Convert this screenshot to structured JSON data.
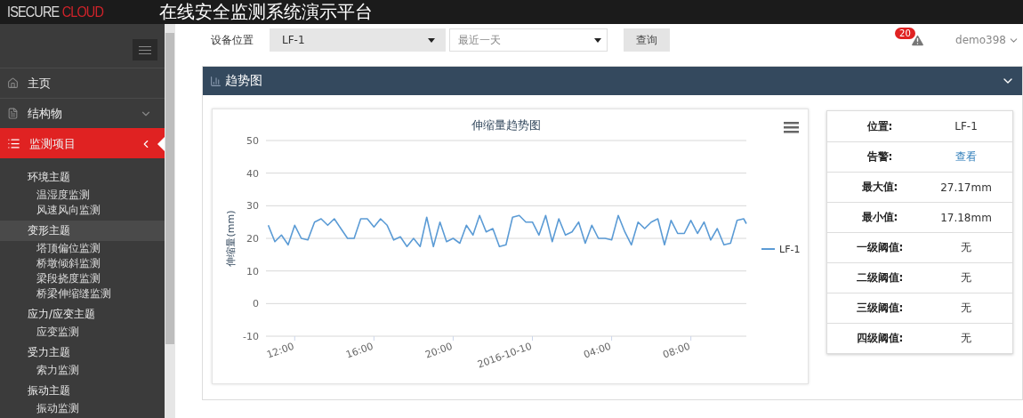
{
  "brand": {
    "part_1": "ISECURE",
    "part_2": "CLOUD"
  },
  "title": "在线安全监测系统演示平台",
  "sidebar": {
    "items": [
      {
        "label": "主页",
        "kind": "home",
        "selected": false
      },
      {
        "label": "结构物",
        "kind": "structure",
        "selected": false,
        "expanded": false
      },
      {
        "label": "监测项目",
        "kind": "monitoring",
        "selected": true,
        "expanded": true
      }
    ],
    "groups": [
      {
        "label": "环境主题",
        "selected": false,
        "children": [
          {
            "label": "温湿度监测"
          },
          {
            "label": "风速风向监测"
          }
        ]
      },
      {
        "label": "变形主题",
        "selected": true,
        "children": [
          {
            "label": "塔顶偏位监测"
          },
          {
            "label": "桥墩倾斜监测"
          },
          {
            "label": "梁段挠度监测"
          },
          {
            "label": "桥梁伸缩缝监测"
          }
        ]
      },
      {
        "label": "应力/应变主题",
        "selected": false,
        "children": [
          {
            "label": "应变监测"
          }
        ]
      },
      {
        "label": "受力主题",
        "selected": false,
        "children": [
          {
            "label": "索力监测"
          }
        ]
      },
      {
        "label": "振动主题",
        "selected": false,
        "children": [
          {
            "label": "振动监测"
          }
        ]
      }
    ]
  },
  "toolbar": {
    "location_label": "设备位置",
    "location": "LF-1",
    "range": "最近一天",
    "query_button": "查询",
    "alert_count": "20",
    "user": "demo398"
  },
  "panel": {
    "title": "趋势图",
    "chart_data": {
      "type": "line",
      "title": "伸缩量趋势图",
      "ylabel": "伸缩量(mm)",
      "grid": true,
      "xlim": [
        "2016-10-09T10:33",
        "2016-10-10T10:48"
      ],
      "ylim": [
        -10,
        50
      ],
      "yticks": [
        -10,
        0,
        10,
        20,
        30,
        40,
        50
      ],
      "xticks": [
        {
          "value": "2016-10-09T12:00",
          "label": "12:00"
        },
        {
          "value": "2016-10-09T16:00",
          "label": "16:00"
        },
        {
          "value": "2016-10-09T20:00",
          "label": "20:00"
        },
        {
          "value": "2016-10-10T00:00",
          "label": "2016-10-10"
        },
        {
          "value": "2016-10-10T04:00",
          "label": "04:00"
        },
        {
          "value": "2016-10-10T08:00",
          "label": "08:00"
        }
      ],
      "x": [
        "2016-10-09T10:40",
        "2016-10-09T11:00",
        "2016-10-09T11:20",
        "2016-10-09T11:40",
        "2016-10-09T12:00",
        "2016-10-09T12:20",
        "2016-10-09T12:40",
        "2016-10-09T13:00",
        "2016-10-09T13:20",
        "2016-10-09T13:40",
        "2016-10-09T14:00",
        "2016-10-09T14:20",
        "2016-10-09T14:40",
        "2016-10-09T15:00",
        "2016-10-09T15:20",
        "2016-10-09T15:40",
        "2016-10-09T16:00",
        "2016-10-09T16:20",
        "2016-10-09T16:40",
        "2016-10-09T17:00",
        "2016-10-09T17:20",
        "2016-10-09T17:40",
        "2016-10-09T18:00",
        "2016-10-09T18:20",
        "2016-10-09T18:40",
        "2016-10-09T19:00",
        "2016-10-09T19:20",
        "2016-10-09T19:40",
        "2016-10-09T20:00",
        "2016-10-09T20:20",
        "2016-10-09T20:40",
        "2016-10-09T21:00",
        "2016-10-09T21:20",
        "2016-10-09T21:40",
        "2016-10-09T22:00",
        "2016-10-09T22:20",
        "2016-10-09T22:40",
        "2016-10-09T23:00",
        "2016-10-09T23:20",
        "2016-10-09T23:40",
        "2016-10-10T00:00",
        "2016-10-10T00:20",
        "2016-10-10T00:40",
        "2016-10-10T01:00",
        "2016-10-10T01:20",
        "2016-10-10T01:40",
        "2016-10-10T02:00",
        "2016-10-10T02:20",
        "2016-10-10T02:40",
        "2016-10-10T03:00",
        "2016-10-10T03:20",
        "2016-10-10T03:40",
        "2016-10-10T04:00",
        "2016-10-10T04:20",
        "2016-10-10T04:40",
        "2016-10-10T05:00",
        "2016-10-10T05:20",
        "2016-10-10T05:40",
        "2016-10-10T06:00",
        "2016-10-10T06:20",
        "2016-10-10T06:40",
        "2016-10-10T07:00",
        "2016-10-10T07:20",
        "2016-10-10T07:40",
        "2016-10-10T08:00",
        "2016-10-10T08:20",
        "2016-10-10T08:40",
        "2016-10-10T09:00",
        "2016-10-10T09:20",
        "2016-10-10T09:40",
        "2016-10-10T10:00",
        "2016-10-10T10:20",
        "2016-10-10T10:40",
        "2016-10-10T10:48"
      ],
      "series": [
        {
          "name": "LF-1",
          "color": "#5b9bd5",
          "values": [
            24,
            19,
            21,
            18,
            24,
            20,
            19.5,
            25,
            26,
            24,
            26,
            23,
            20,
            20,
            26,
            26,
            23.5,
            26,
            24,
            19.5,
            20.5,
            17.5,
            20,
            17.5,
            26.5,
            17.5,
            25,
            19,
            20,
            18.5,
            24,
            21,
            27,
            22,
            23,
            17.5,
            18,
            26.5,
            27,
            25,
            25,
            21,
            27,
            19,
            26,
            21,
            22,
            25,
            18.5,
            24,
            20,
            20,
            19.5,
            27,
            22,
            18,
            25,
            23,
            25,
            26,
            18,
            25.5,
            21.5,
            21.5,
            25.5,
            21.5,
            25,
            19.5,
            23,
            18,
            18.5,
            25.5,
            26,
            24.5
          ]
        }
      ]
    },
    "info": [
      {
        "label": "位置:",
        "value": "LF-1",
        "kind": "text"
      },
      {
        "label": "告警:",
        "value": "查看",
        "kind": "link"
      },
      {
        "label": "最大值:",
        "value": "27.17mm",
        "kind": "text"
      },
      {
        "label": "最小值:",
        "value": "17.18mm",
        "kind": "text"
      },
      {
        "label": "一级阈值:",
        "value": "无",
        "kind": "text"
      },
      {
        "label": "二级阈值:",
        "value": "无",
        "kind": "text"
      },
      {
        "label": "三级阈值:",
        "value": "无",
        "kind": "text"
      },
      {
        "label": "四级阈值:",
        "value": "无",
        "kind": "text"
      }
    ]
  }
}
